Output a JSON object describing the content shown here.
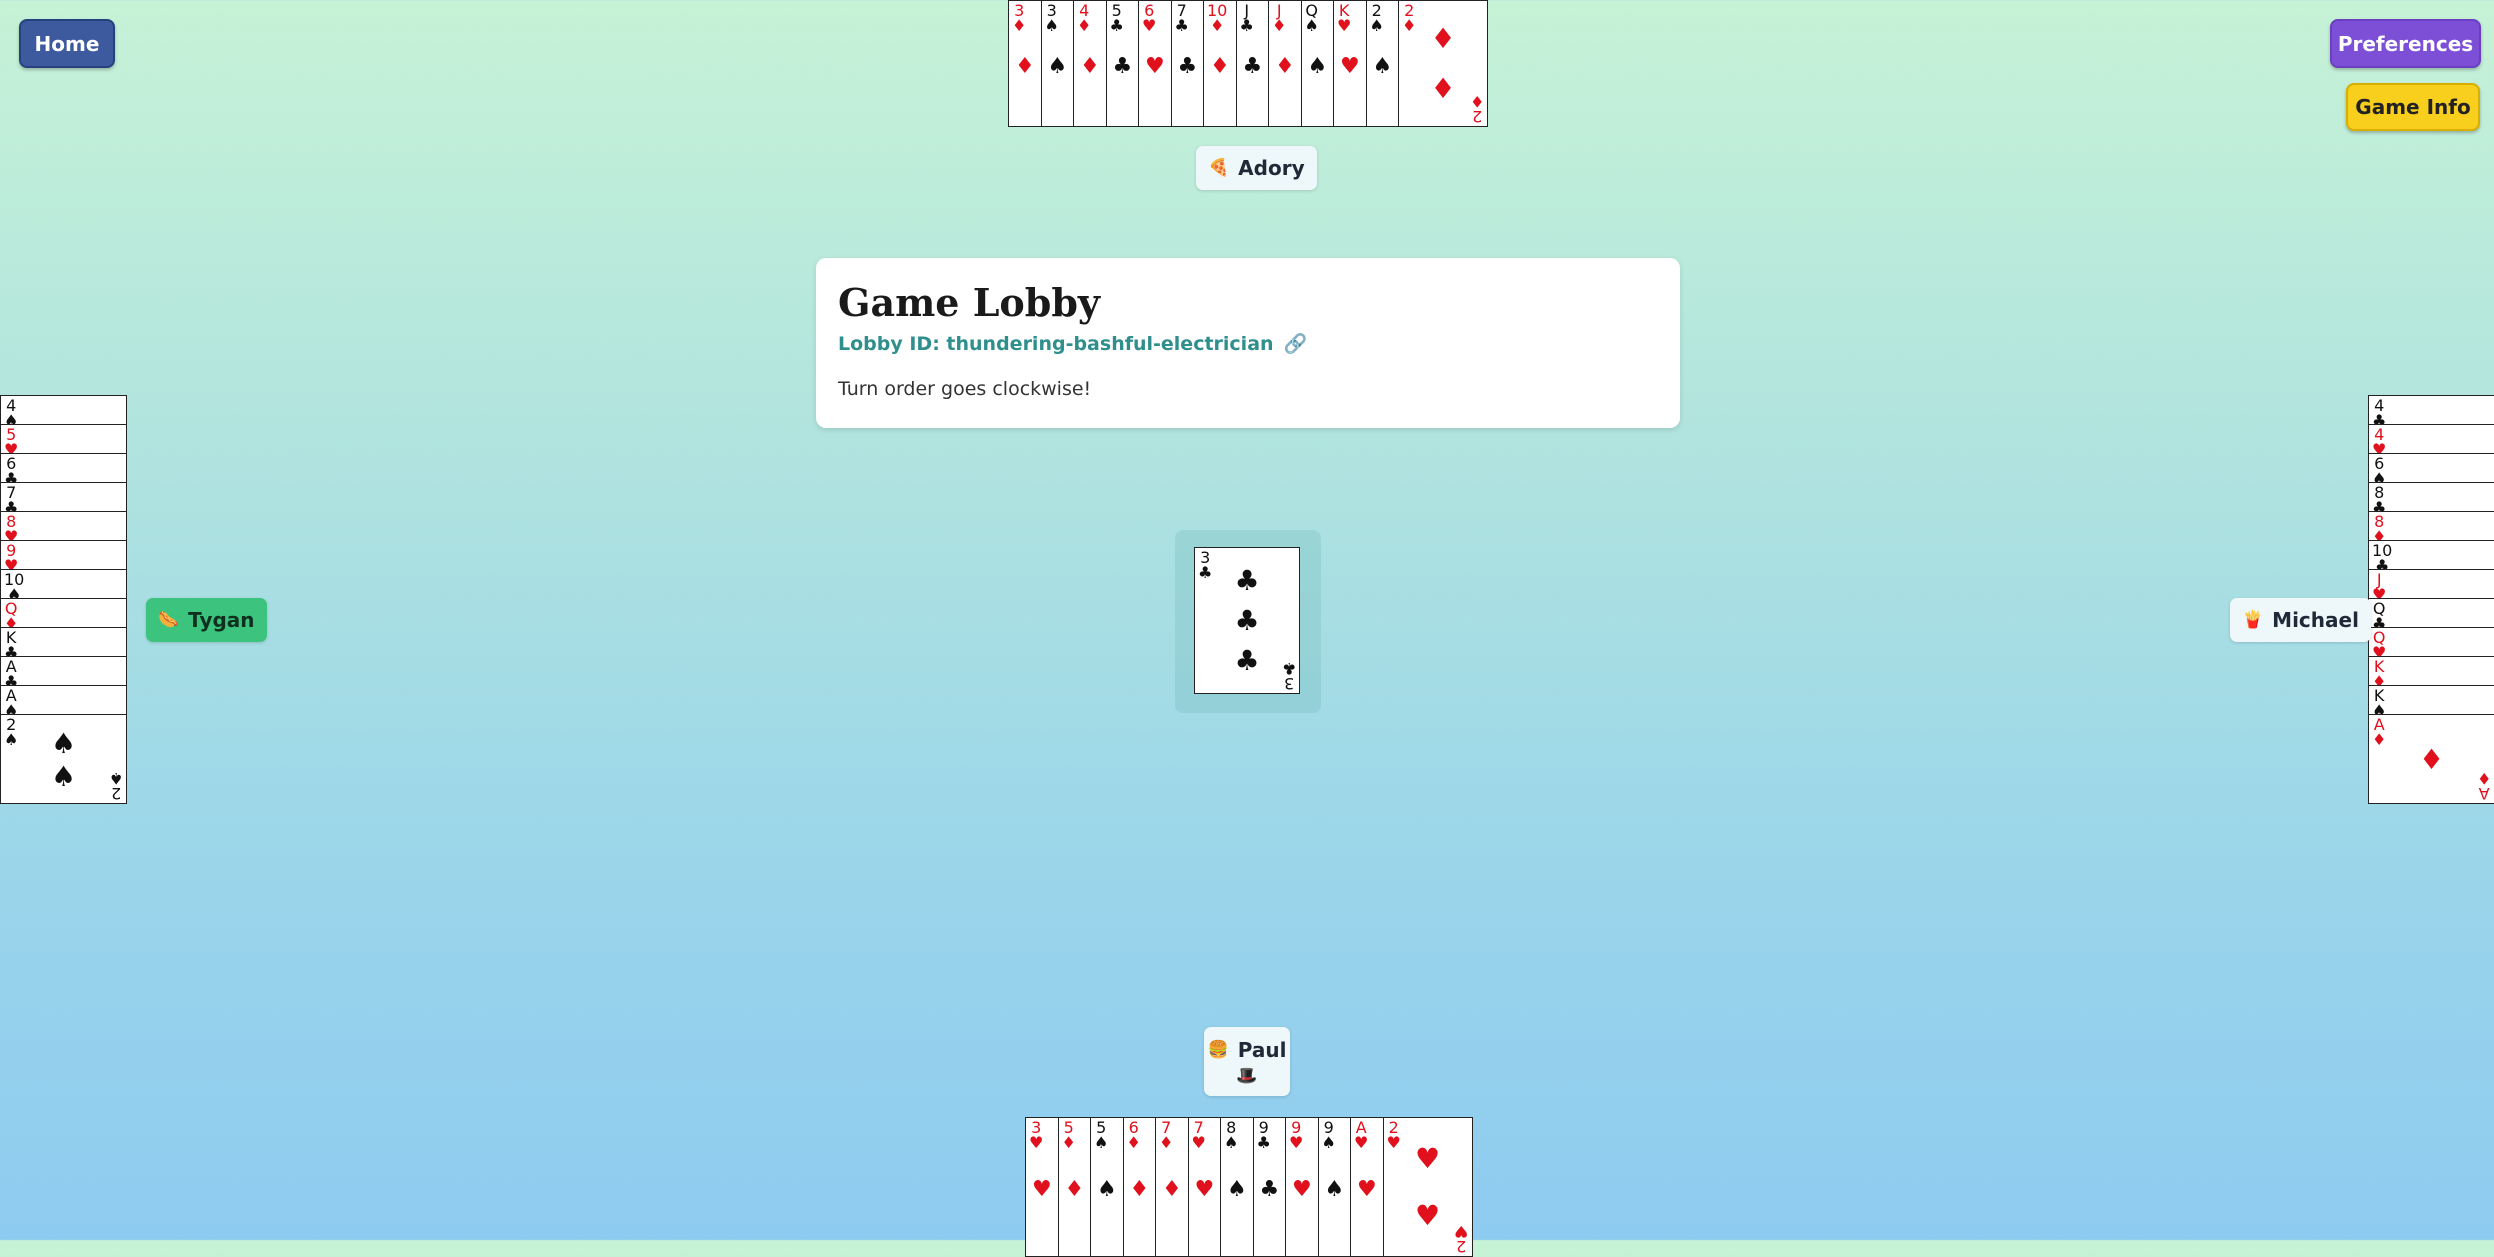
{
  "nav": {
    "home_label": "Home",
    "preferences_label": "Preferences",
    "game_info_label": "Game Info"
  },
  "players": {
    "top": {
      "name": "Adory",
      "emoji": "🍕"
    },
    "left": {
      "name": "Tygan",
      "emoji": "🌭"
    },
    "right": {
      "name": "Michael",
      "emoji": "🍟"
    },
    "bottom": {
      "name": "Paul",
      "emoji": "🍔",
      "badge": "🎩"
    }
  },
  "lobby": {
    "title": "Game Lobby",
    "lobby_id": "Lobby ID: thundering-bashful-electrician",
    "link_icon": "🔗",
    "turn_note": "Turn order goes clockwise!"
  },
  "pile_card": {
    "rank": "3",
    "suit": "♣"
  },
  "hands": {
    "top": [
      {
        "rank": "3",
        "suit": "♦"
      },
      {
        "rank": "3",
        "suit": "♠"
      },
      {
        "rank": "4",
        "suit": "♦"
      },
      {
        "rank": "5",
        "suit": "♣"
      },
      {
        "rank": "6",
        "suit": "♥"
      },
      {
        "rank": "7",
        "suit": "♣"
      },
      {
        "rank": "10",
        "suit": "♦"
      },
      {
        "rank": "J",
        "suit": "♣"
      },
      {
        "rank": "J",
        "suit": "♦"
      },
      {
        "rank": "Q",
        "suit": "♠"
      },
      {
        "rank": "K",
        "suit": "♥"
      },
      {
        "rank": "2",
        "suit": "♠"
      },
      {
        "rank": "2",
        "suit": "♦"
      }
    ],
    "bottom": [
      {
        "rank": "3",
        "suit": "♥"
      },
      {
        "rank": "5",
        "suit": "♦"
      },
      {
        "rank": "5",
        "suit": "♠"
      },
      {
        "rank": "6",
        "suit": "♦"
      },
      {
        "rank": "7",
        "suit": "♦"
      },
      {
        "rank": "7",
        "suit": "♥"
      },
      {
        "rank": "8",
        "suit": "♠"
      },
      {
        "rank": "9",
        "suit": "♣"
      },
      {
        "rank": "9",
        "suit": "♥"
      },
      {
        "rank": "9",
        "suit": "♠"
      },
      {
        "rank": "A",
        "suit": "♥"
      },
      {
        "rank": "2",
        "suit": "♥"
      }
    ],
    "left": [
      {
        "rank": "4",
        "suit": "♠"
      },
      {
        "rank": "5",
        "suit": "♥"
      },
      {
        "rank": "6",
        "suit": "♣"
      },
      {
        "rank": "7",
        "suit": "♣"
      },
      {
        "rank": "8",
        "suit": "♥"
      },
      {
        "rank": "9",
        "suit": "♥"
      },
      {
        "rank": "10",
        "suit": "♠"
      },
      {
        "rank": "Q",
        "suit": "♦"
      },
      {
        "rank": "K",
        "suit": "♣"
      },
      {
        "rank": "A",
        "suit": "♣"
      },
      {
        "rank": "A",
        "suit": "♠"
      },
      {
        "rank": "2",
        "suit": "♠"
      }
    ],
    "right": [
      {
        "rank": "4",
        "suit": "♣"
      },
      {
        "rank": "4",
        "suit": "♥"
      },
      {
        "rank": "6",
        "suit": "♠"
      },
      {
        "rank": "8",
        "suit": "♣"
      },
      {
        "rank": "8",
        "suit": "♦"
      },
      {
        "rank": "10",
        "suit": "♣"
      },
      {
        "rank": "J",
        "suit": "♥"
      },
      {
        "rank": "Q",
        "suit": "♣"
      },
      {
        "rank": "Q",
        "suit": "♥"
      },
      {
        "rank": "K",
        "suit": "♦"
      },
      {
        "rank": "K",
        "suit": "♠"
      },
      {
        "rank": "A",
        "suit": "♦"
      }
    ]
  }
}
